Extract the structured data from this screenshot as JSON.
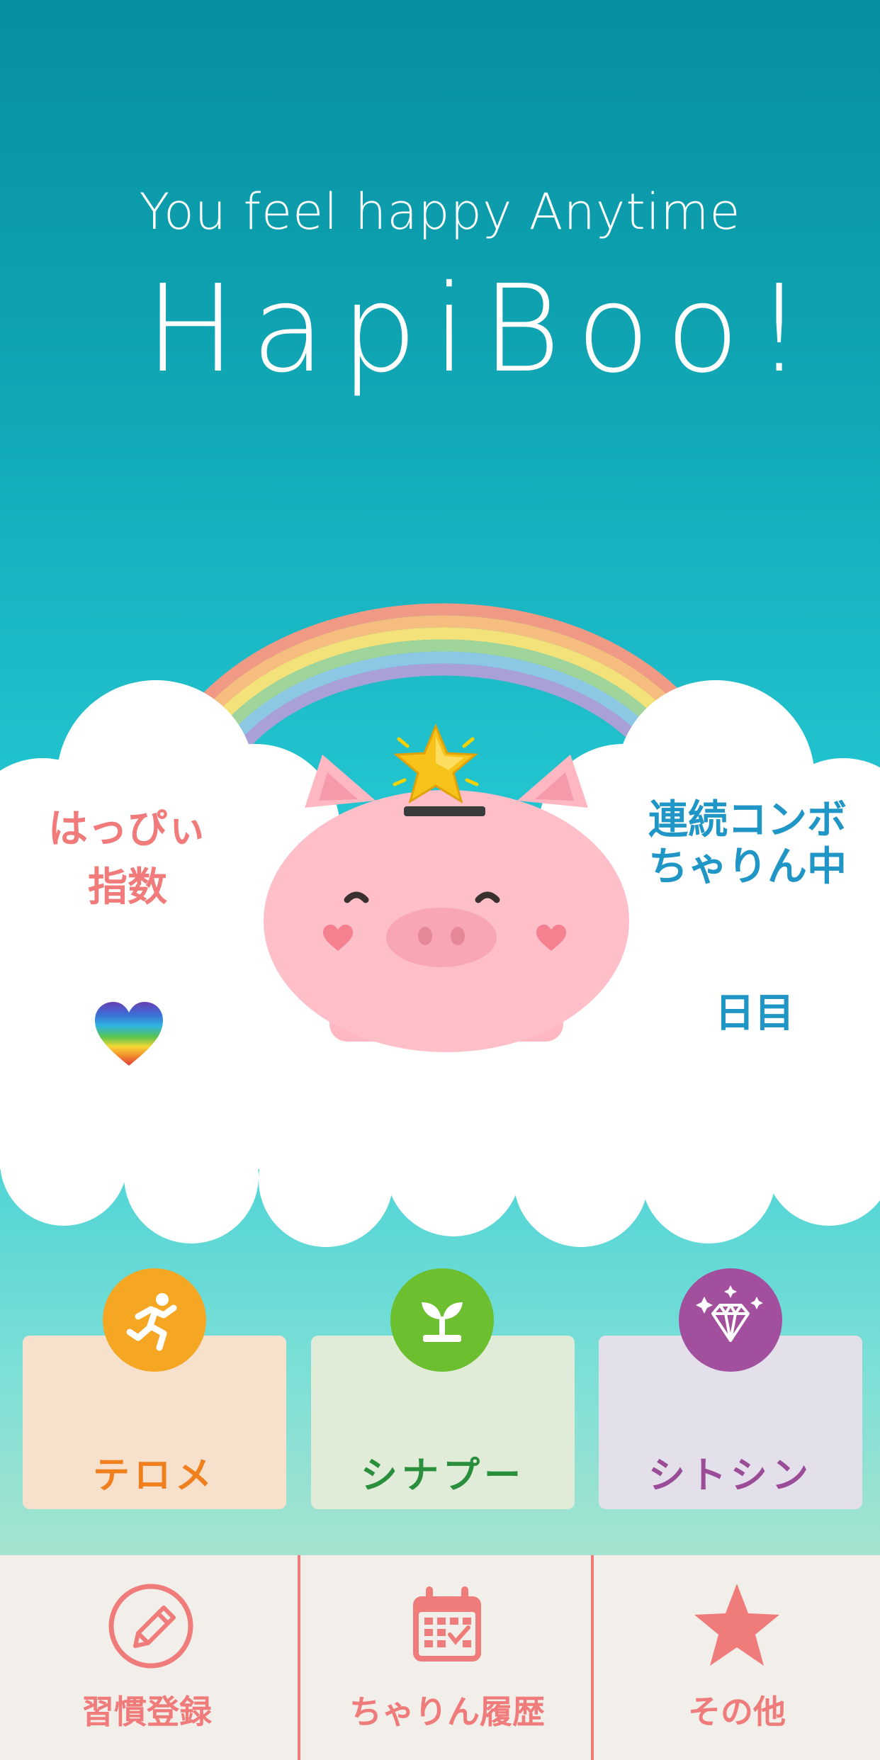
{
  "header": {
    "tagline": "You feel happy Anytime",
    "logo": "HapiBoo!"
  },
  "cloud": {
    "happy_index_line1": "はっぴぃ",
    "happy_index_line2": "指数",
    "combo_line1": "連続コンボ",
    "combo_line2": "ちゃりん中",
    "days_suffix": "日目"
  },
  "cards": [
    {
      "label": "テロメ",
      "icon": "running-person-icon",
      "label_color": "#f07f1d",
      "bg": "#f7e1cd",
      "icon_bg": "#f5a623"
    },
    {
      "label": "シナプー",
      "icon": "sprout-icon",
      "label_color": "#2a8f3d",
      "bg": "#e0ecd8",
      "icon_bg": "#6cbf2f"
    },
    {
      "label": "シトシン",
      "icon": "diamond-icon",
      "label_color": "#9b4c96",
      "bg": "#e3e0ec",
      "icon_bg": "#a24f9e"
    }
  ],
  "bottom_nav": [
    {
      "label": "習慣登録",
      "icon": "pencil-icon"
    },
    {
      "label": "ちゃりん履歴",
      "icon": "calendar-icon"
    },
    {
      "label": "その他",
      "icon": "star-icon"
    }
  ],
  "colors": {
    "accent_coral": "#ef7b7b",
    "combo_blue": "#1f96c6",
    "pig_pink": "#ffc0c8"
  }
}
